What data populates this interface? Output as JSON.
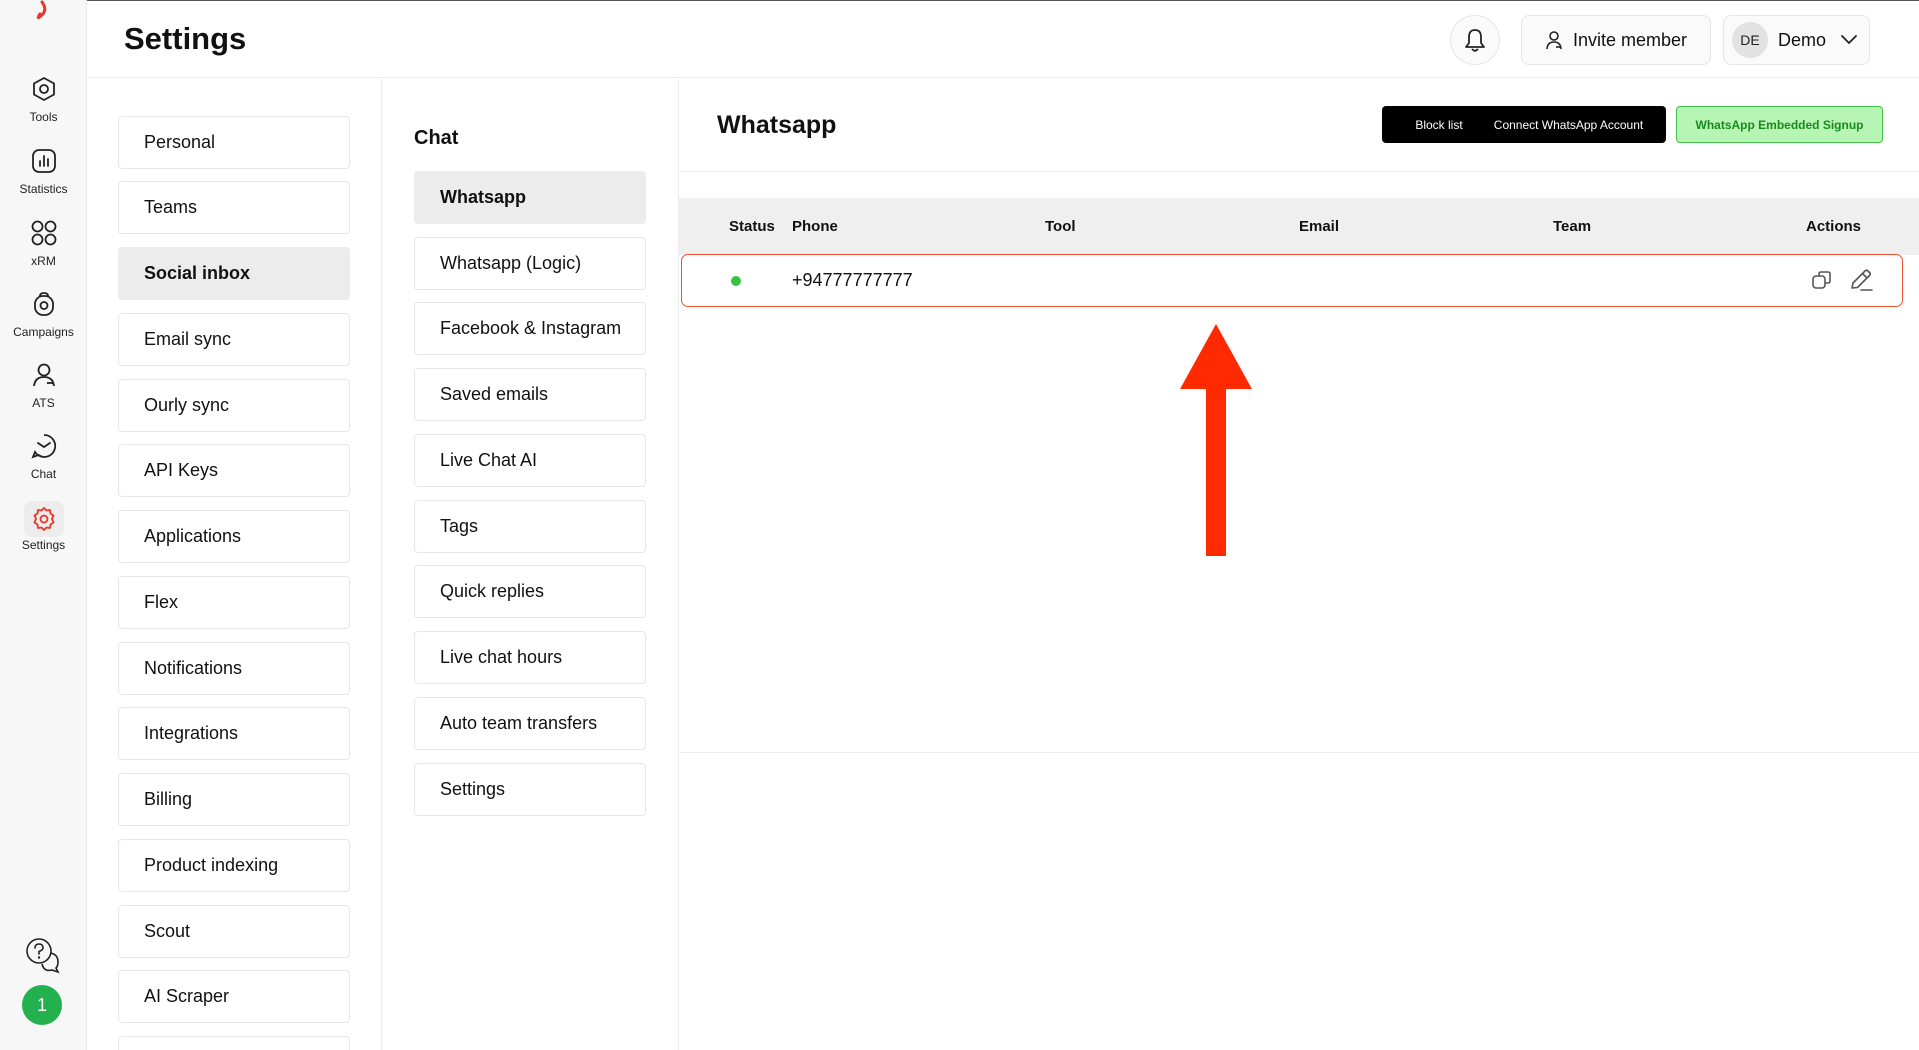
{
  "header": {
    "title": "Settings",
    "invite_label": "Invite member",
    "user_initials": "DE",
    "user_name": "Demo",
    "icons": {
      "bell": "bell-icon",
      "invite": "user-icon",
      "user_menu": "chevron-down-icon"
    }
  },
  "rail": {
    "items": [
      {
        "label": "Tools",
        "icon": "hexagon-settings-icon"
      },
      {
        "label": "Statistics",
        "icon": "bar-chart-icon"
      },
      {
        "label": "xRM",
        "icon": "grid-icon"
      },
      {
        "label": "Campaigns",
        "icon": "campaign-icon"
      },
      {
        "label": "ATS",
        "icon": "user-icon"
      },
      {
        "label": "Chat",
        "icon": "chat-icon"
      },
      {
        "label": "Settings",
        "icon": "gear-icon"
      }
    ],
    "active": "Settings",
    "avatar_text": "1",
    "accent_color": "#e8362a"
  },
  "settings_nav": {
    "items": [
      "Personal",
      "Teams",
      "Social inbox",
      "Email sync",
      "Ourly sync",
      "API Keys",
      "Applications",
      "Flex",
      "Notifications",
      "Integrations",
      "Billing",
      "Product indexing",
      "Scout",
      "AI Scraper"
    ],
    "active": "Social inbox"
  },
  "chat_nav": {
    "title": "Chat",
    "items": [
      "Whatsapp",
      "Whatsapp (Logic)",
      "Facebook & Instagram",
      "Saved emails",
      "Live Chat AI",
      "Tags",
      "Quick replies",
      "Live chat hours",
      "Auto team transfers",
      "Settings"
    ],
    "active": "Whatsapp"
  },
  "main": {
    "title": "Whatsapp",
    "buttons": {
      "block_list": "Block list",
      "connect": "Connect WhatsApp Account",
      "embedded": "WhatsApp Embedded Signup"
    },
    "table": {
      "columns": [
        "Status",
        "Phone",
        "Tool",
        "Email",
        "Team",
        "Actions"
      ],
      "rows": [
        {
          "status": "active",
          "status_color": "#38c43e",
          "phone": "+94777777777",
          "tool": "",
          "email": "",
          "team": ""
        }
      ]
    }
  },
  "colors": {
    "highlight_border": "#f0502e",
    "arrow": "#ff2a00",
    "green_button_bg": "#b6f5b4",
    "green_button_text": "#1a8a1f"
  }
}
